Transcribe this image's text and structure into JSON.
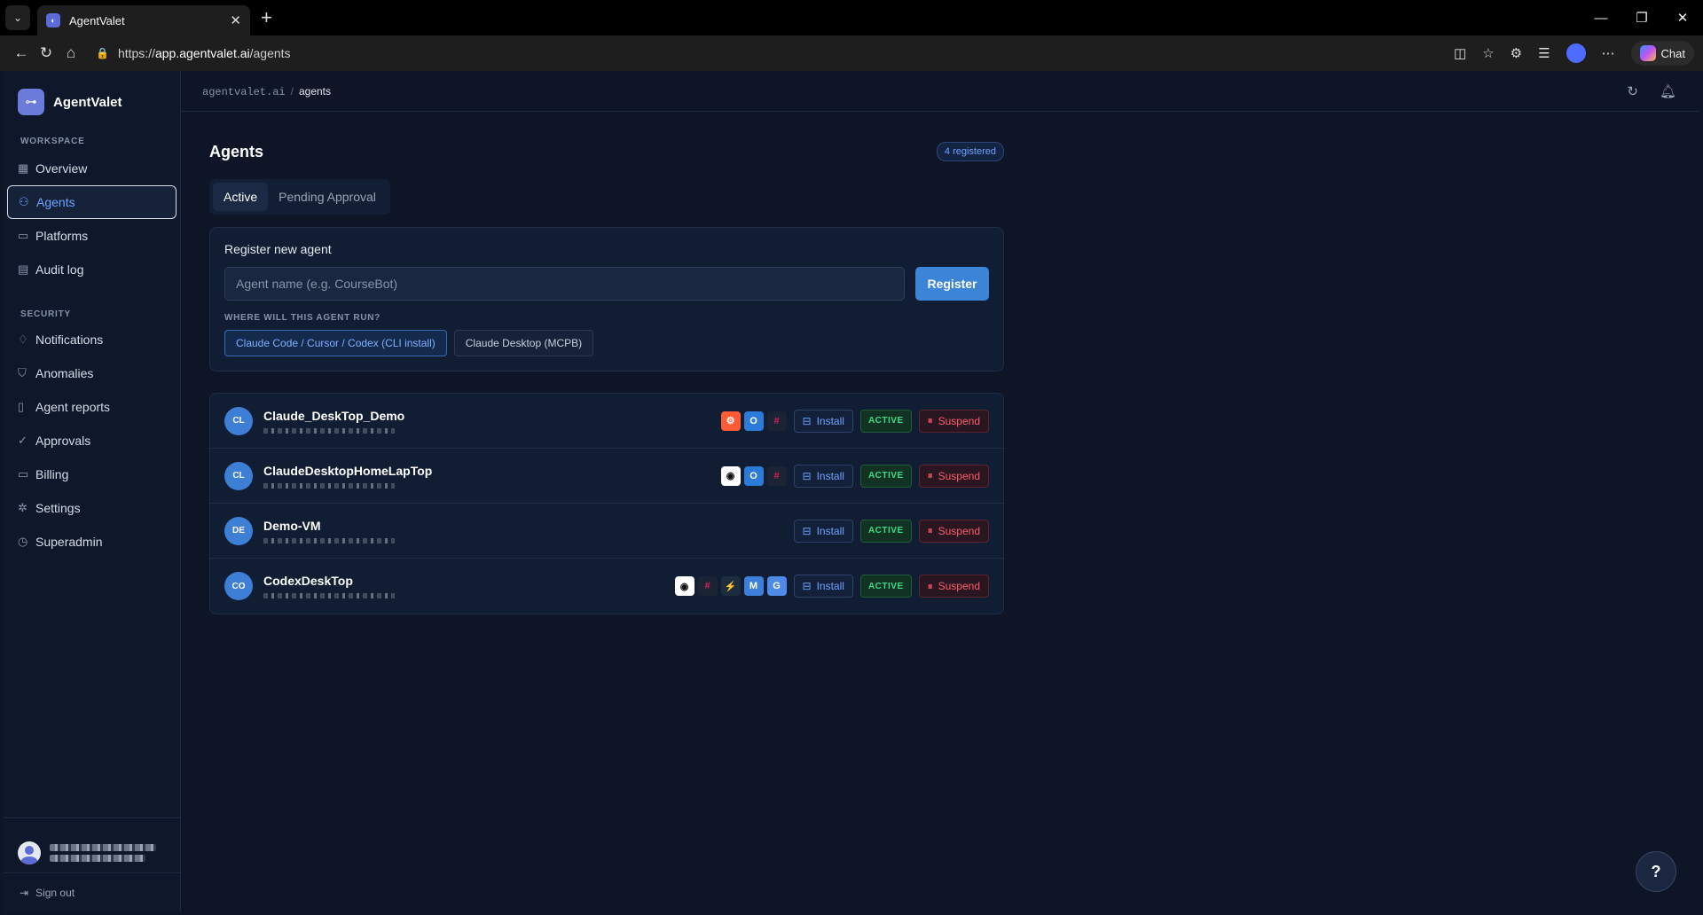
{
  "browser": {
    "tab_title": "AgentValet",
    "url_scheme": "https://",
    "url_host": "app.agentvalet.ai",
    "url_path": "/agents",
    "chat_label": "Chat"
  },
  "sidebar": {
    "brand": "AgentValet",
    "workspace_label": "WORKSPACE",
    "workspace_items": [
      {
        "label": "Overview",
        "icon": "grid-icon"
      },
      {
        "label": "Agents",
        "icon": "user-icon"
      },
      {
        "label": "Platforms",
        "icon": "briefcase-icon"
      },
      {
        "label": "Audit log",
        "icon": "document-icon"
      }
    ],
    "security_label": "SECURITY",
    "security_items": [
      {
        "label": "Notifications",
        "icon": "bell-icon"
      },
      {
        "label": "Anomalies",
        "icon": "shield-icon"
      },
      {
        "label": "Agent reports",
        "icon": "report-icon"
      },
      {
        "label": "Approvals",
        "icon": "check-circle-icon"
      },
      {
        "label": "Billing",
        "icon": "card-icon"
      },
      {
        "label": "Settings",
        "icon": "gear-icon"
      },
      {
        "label": "Superadmin",
        "icon": "clock-icon"
      }
    ],
    "signout": "Sign out"
  },
  "topbar": {
    "crumb_root": "agentvalet.ai",
    "crumb_sep": "/",
    "crumb_current": "agents"
  },
  "page": {
    "title": "Agents",
    "count_badge": "4 registered",
    "tabs": [
      "Active",
      "Pending Approval"
    ]
  },
  "register": {
    "title": "Register new agent",
    "placeholder": "Agent name (e.g. CourseBot)",
    "button": "Register",
    "run_label": "WHERE WILL THIS AGENT RUN?",
    "options": [
      "Claude Code / Cursor / Codex (CLI install)",
      "Claude Desktop (MCPB)"
    ]
  },
  "agents": [
    {
      "initials": "CL",
      "name": "Claude_DeskTop_Demo",
      "platforms": [
        "hubspot",
        "outlook",
        "slack"
      ],
      "install": "Install",
      "status": "ACTIVE",
      "suspend": "Suspend"
    },
    {
      "initials": "CL",
      "name": "ClaudeDesktopHomeLapTop",
      "platforms": [
        "github",
        "outlook",
        "slack"
      ],
      "install": "Install",
      "status": "ACTIVE",
      "suspend": "Suspend"
    },
    {
      "initials": "DE",
      "name": "Demo-VM",
      "platforms": [],
      "install": "Install",
      "status": "ACTIVE",
      "suspend": "Suspend"
    },
    {
      "initials": "CO",
      "name": "CodexDeskTop",
      "platforms": [
        "github",
        "slack",
        "zapier",
        "gmail",
        "gdocs"
      ],
      "install": "Install",
      "status": "ACTIVE",
      "suspend": "Suspend"
    }
  ],
  "platform_glyphs": {
    "hubspot": "⚙",
    "outlook": "O",
    "slack": "#",
    "github": "◉",
    "zapier": "⚡",
    "gmail": "M",
    "gdocs": "G"
  },
  "help": "?"
}
